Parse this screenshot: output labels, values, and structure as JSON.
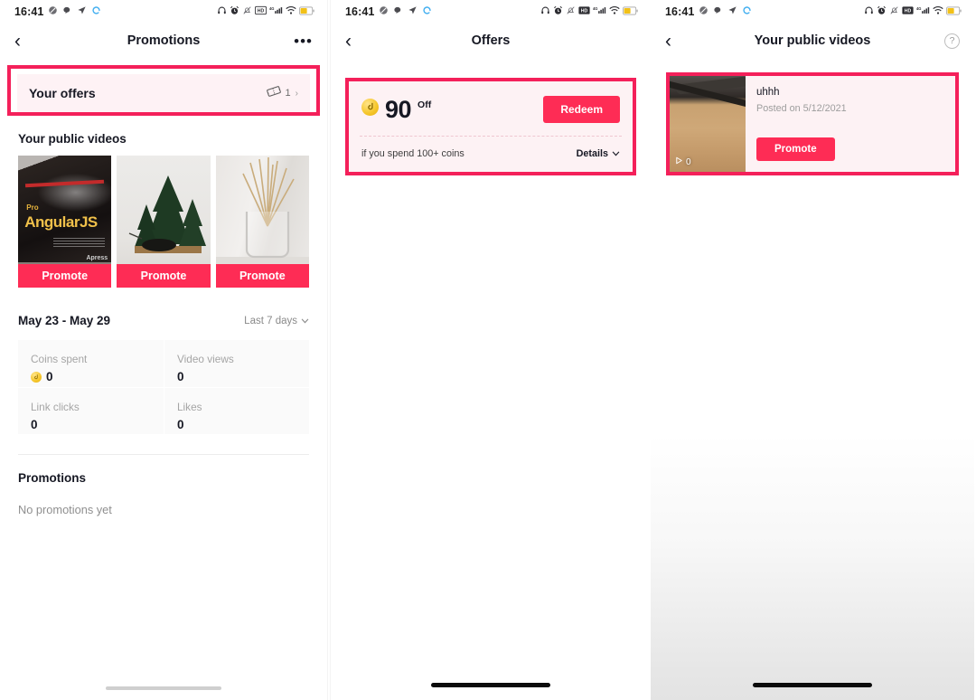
{
  "status_bar": {
    "time": "16:41",
    "left_icons": [
      "mute-icon",
      "chat-icon",
      "location-icon",
      "sync-icon"
    ],
    "right_icons": [
      "headphones-icon",
      "alarm-icon",
      "bell-off-icon",
      "hd-icon",
      "signal-4g-icon",
      "wifi-icon",
      "battery-icon"
    ],
    "network": "4G"
  },
  "colors": {
    "accent_red": "#fe2c55",
    "highlight_border": "#f4205a",
    "card_pink": "#fdf2f4",
    "coin_yellow": "#f5c528",
    "text_dark": "#161823",
    "text_muted": "#a5a5a5"
  },
  "panel1": {
    "nav": {
      "back": "‹",
      "title": "Promotions",
      "more": "•••"
    },
    "offers_row": {
      "label": "Your offers",
      "icon": "ticket-icon",
      "count": "1",
      "chevron": "›"
    },
    "videos_section": {
      "title": "Your public videos",
      "items": [
        {
          "alt": "Pro AngularJS book cover",
          "promote_label": "Promote",
          "title_line1": "Pro",
          "title_line2": "AngularJS",
          "publisher": "Apress"
        },
        {
          "alt": "wooden pine tree ornament",
          "promote_label": "Promote"
        },
        {
          "alt": "dried wheat stems in glass vase",
          "promote_label": "Promote"
        }
      ]
    },
    "date_row": {
      "range": "May 23 - May 29",
      "selector": "Last 7 days",
      "chevron": "∨"
    },
    "stats": [
      {
        "label": "Coins spent",
        "value": "0",
        "has_coin": true
      },
      {
        "label": "Video views",
        "value": "0",
        "has_coin": false
      },
      {
        "label": "Link clicks",
        "value": "0",
        "has_coin": false
      },
      {
        "label": "Likes",
        "value": "0",
        "has_coin": false
      }
    ],
    "promotions": {
      "title": "Promotions",
      "empty_text": "No promotions yet"
    }
  },
  "panel2": {
    "nav": {
      "back": "‹",
      "title": "Offers"
    },
    "offer": {
      "coin_icon": "coin-icon",
      "amount": "90",
      "off_label": "Off",
      "redeem_label": "Redeem",
      "condition": "if you spend 100+ coins",
      "details_label": "Details",
      "details_chevron": "∨"
    }
  },
  "panel3": {
    "nav": {
      "back": "‹",
      "title": "Your public videos",
      "help": "?"
    },
    "video": {
      "title": "uhhh",
      "posted": "Posted on 5/12/2021",
      "play_icon": "play-icon",
      "play_count": "0",
      "promote_label": "Promote",
      "thumb_alt": "eyeglasses on wooden table"
    }
  }
}
